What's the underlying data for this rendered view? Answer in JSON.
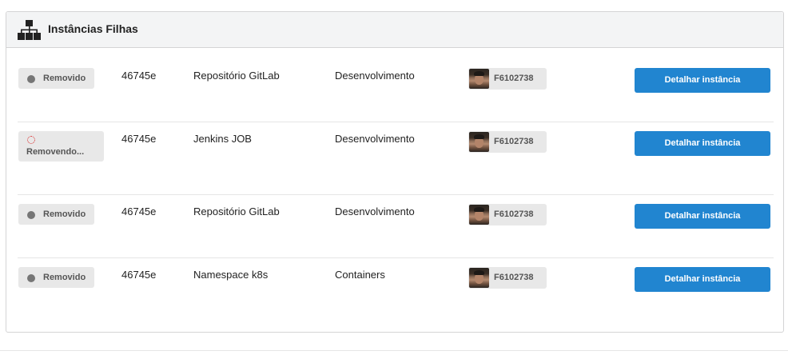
{
  "panel": {
    "title": "Instâncias Filhas",
    "icon": "sitemap-icon"
  },
  "rows": [
    {
      "status": "Removido",
      "status_kind": "removed",
      "id": "46745e",
      "name": "Repositório GitLab",
      "environment": "Desenvolvimento",
      "user": "F6102738",
      "action": "Detalhar instância"
    },
    {
      "status": "Removendo...",
      "status_kind": "removing",
      "id": "46745e",
      "name": "Jenkins JOB",
      "environment": "Desenvolvimento",
      "user": "F6102738",
      "action": "Detalhar instância"
    },
    {
      "status": "Removido",
      "status_kind": "removed",
      "id": "46745e",
      "name": "Repositório GitLab",
      "environment": "Desenvolvimento",
      "user": "F6102738",
      "action": "Detalhar instância"
    },
    {
      "status": "Removido",
      "status_kind": "removed",
      "id": "46745e",
      "name": "Namespace k8s",
      "environment": "Containers",
      "user": "F6102738",
      "action": "Detalhar instância"
    }
  ],
  "colors": {
    "primary_button": "#2185d0",
    "status_removed_dot": "#767676",
    "status_removing_spinner": "#db2828",
    "label_background": "#e8e8e8"
  }
}
